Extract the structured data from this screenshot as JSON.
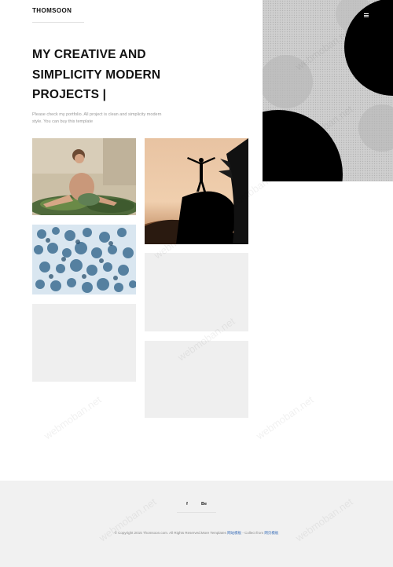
{
  "header": {
    "logo": "THOMSOON"
  },
  "hero": {
    "menu_icon": "hamburger-icon"
  },
  "intro": {
    "headline_line1": "MY CREATIVE AND",
    "headline_line2": "SIMPLICITY MODERN",
    "headline_line3": "PROJECTS |",
    "description": "Please check my portfolio. All project is clean and simplicity modern style. You can buy this template"
  },
  "portfolio": {
    "items": [
      {
        "subject": "woman sitting among greenery"
      },
      {
        "subject": "person with raised arms on rock at sunset"
      },
      {
        "subject": "aerial view of snowy forest"
      },
      {
        "subject": "empty placeholder"
      },
      {
        "subject": "empty placeholder"
      },
      {
        "subject": "empty placeholder"
      }
    ]
  },
  "footer": {
    "social": [
      {
        "label": "f",
        "icon": "facebook-icon"
      },
      {
        "label": "Be",
        "icon": "behance-icon"
      }
    ],
    "copyright_text": "© Copyright 2015 Thomsoon.com. All Rights Reserved.More Templates",
    "more_templates_link": "网站模板",
    "collect_text": "- Collect from",
    "collect_link": "网页模板"
  },
  "watermark": {
    "text": "webmoban.net"
  },
  "colors": {
    "footer_bg": "#f1f1f1",
    "link": "#3b6fb8",
    "hero_gray": "#c9c9c9"
  }
}
